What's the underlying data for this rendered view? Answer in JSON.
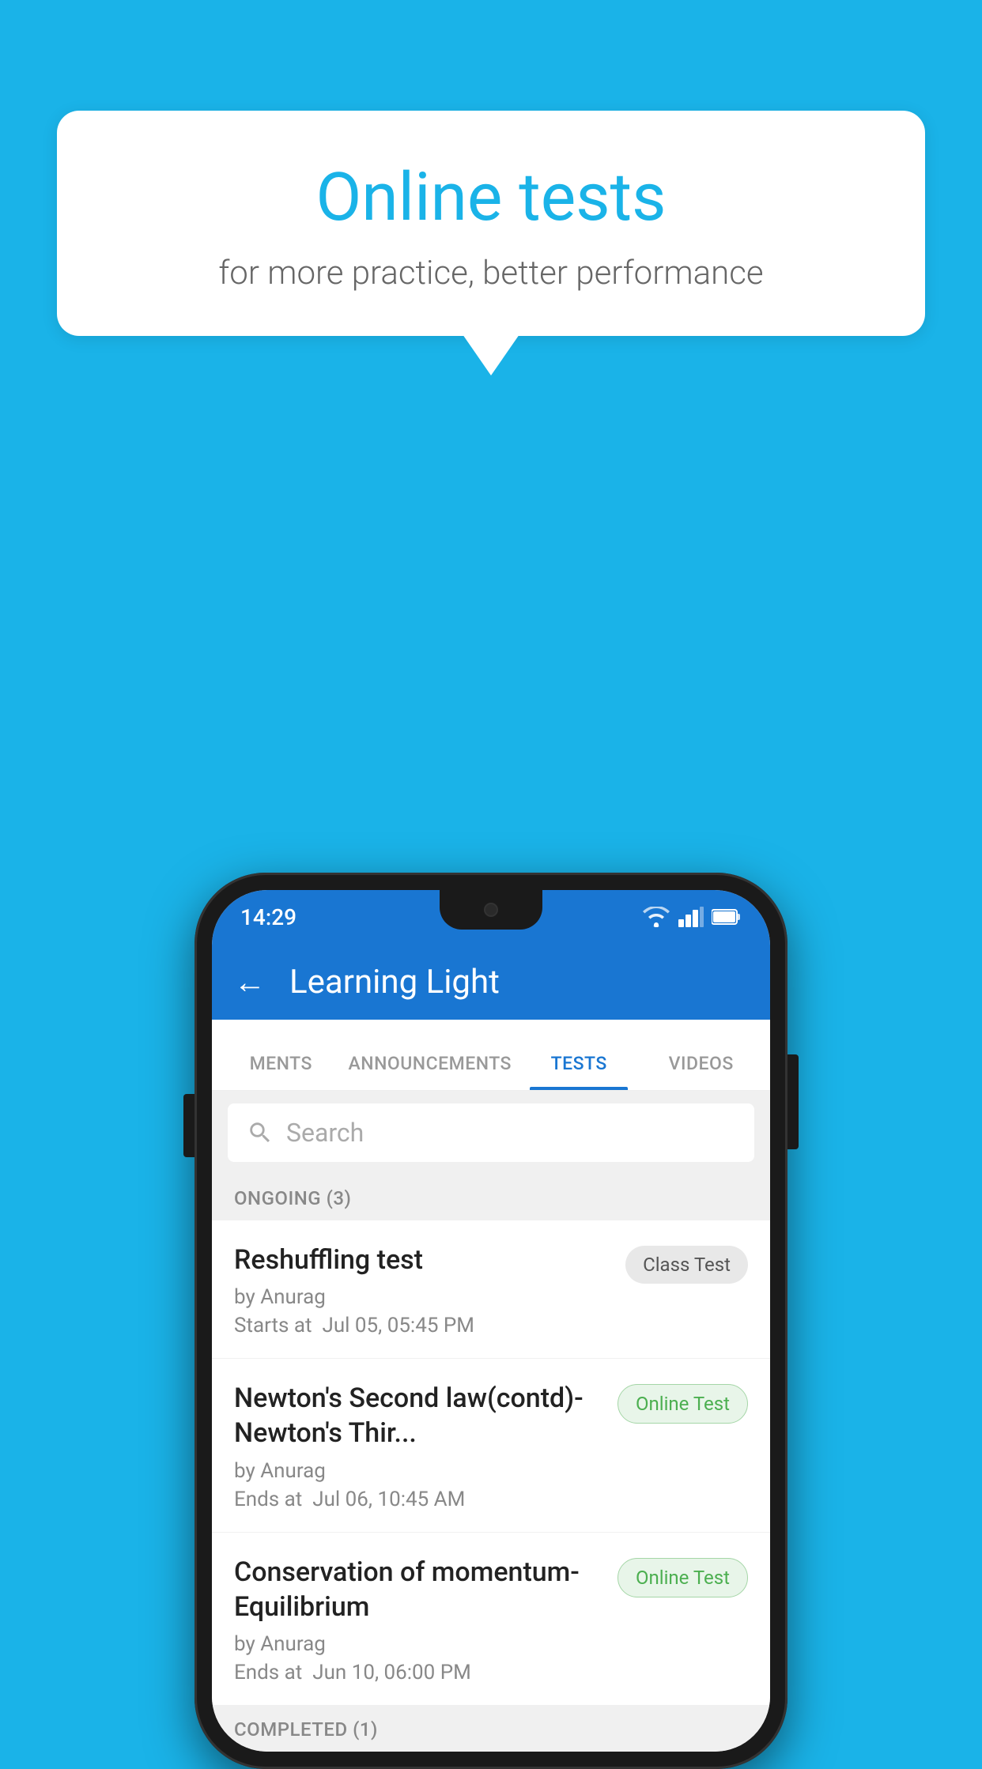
{
  "background_color": "#1ab3e8",
  "speech_bubble": {
    "title": "Online tests",
    "subtitle": "for more practice, better performance"
  },
  "status_bar": {
    "time": "14:29",
    "wifi": true,
    "signal": true,
    "battery": true
  },
  "app_bar": {
    "title": "Learning Light",
    "back_label": "←"
  },
  "tabs": [
    {
      "label": "MENTS",
      "active": false
    },
    {
      "label": "ANNOUNCEMENTS",
      "active": false
    },
    {
      "label": "TESTS",
      "active": true
    },
    {
      "label": "VIDEOS",
      "active": false
    }
  ],
  "search": {
    "placeholder": "Search"
  },
  "ongoing_section": {
    "label": "ONGOING (3)"
  },
  "test_items": [
    {
      "title": "Reshuffling test",
      "author": "by Anurag",
      "date_label": "Starts at",
      "date": "Jul 05, 05:45 PM",
      "badge": "Class Test",
      "badge_type": "class"
    },
    {
      "title": "Newton's Second law(contd)-Newton's Thir...",
      "author": "by Anurag",
      "date_label": "Ends at",
      "date": "Jul 06, 10:45 AM",
      "badge": "Online Test",
      "badge_type": "online"
    },
    {
      "title": "Conservation of momentum-Equilibrium",
      "author": "by Anurag",
      "date_label": "Ends at",
      "date": "Jun 10, 06:00 PM",
      "badge": "Online Test",
      "badge_type": "online"
    }
  ],
  "completed_section": {
    "label": "COMPLETED (1)"
  }
}
